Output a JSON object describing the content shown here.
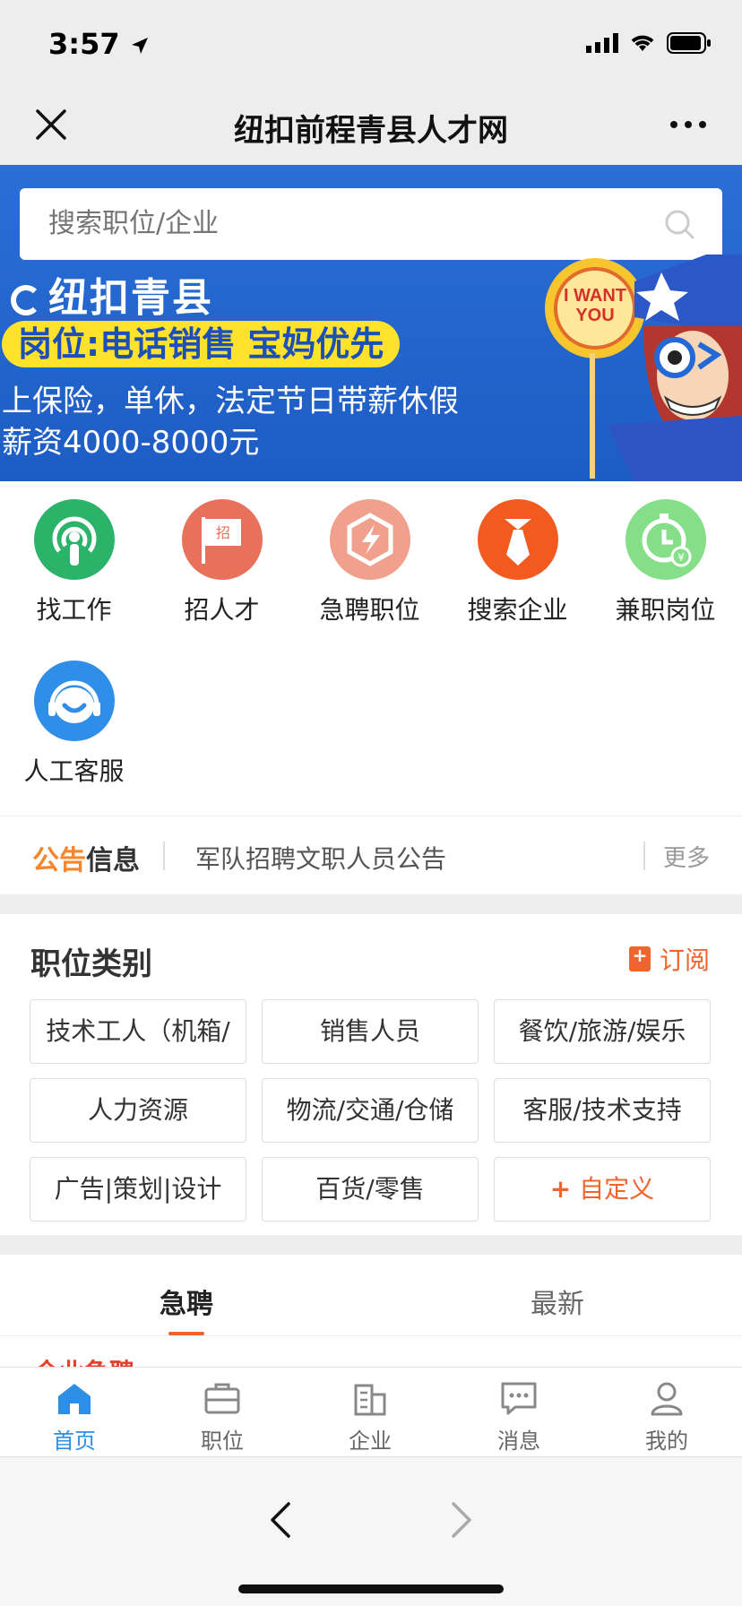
{
  "status_bar": {
    "time": "3:57"
  },
  "nav": {
    "title": "纽扣前程青县人才网"
  },
  "search": {
    "placeholder": "搜索职位/企业"
  },
  "banner": {
    "logo_text": "纽扣青县",
    "tag": "岗位:电话销售 宝妈优先",
    "line1": "上保险，单休，法定节日带薪休假",
    "line2": "薪资4000-8000元",
    "art_text": "I WANT YOU"
  },
  "quick_links": [
    {
      "label": "找工作",
      "icon": "podcast-person-icon",
      "color": "#2bb36a"
    },
    {
      "label": "招人才",
      "icon": "recruit-flag-icon",
      "color": "#e8715b"
    },
    {
      "label": "急聘职位",
      "icon": "lightning-icon",
      "color": "#f0a08c"
    },
    {
      "label": "搜索企业",
      "icon": "tie-icon",
      "color": "#f25a1f"
    },
    {
      "label": "兼职岗位",
      "icon": "clock-yen-icon",
      "color": "#85df88"
    },
    {
      "label": "人工客服",
      "icon": "headset-smile-icon",
      "color": "#2f8ee8"
    }
  ],
  "notice": {
    "title_a": "公告",
    "title_b": "信息",
    "text": "军队招聘文职人员公告",
    "more": "更多"
  },
  "categories": {
    "title": "职位类别",
    "subscribe": "订阅",
    "items": [
      "技术工人（机箱/",
      "销售人员",
      "餐饮/旅游/娱乐",
      "人力资源",
      "物流/交通/仓储",
      "客服/技术支持",
      "广告|策划|设计",
      "百货/零售"
    ],
    "custom": "自定义"
  },
  "tabs": {
    "active": "急聘",
    "inactive": "最新",
    "peek": "企业急聘"
  },
  "bottom_nav": [
    {
      "label": "首页",
      "icon": "home-icon"
    },
    {
      "label": "职位",
      "icon": "briefcase-icon"
    },
    {
      "label": "企业",
      "icon": "building-icon"
    },
    {
      "label": "消息",
      "icon": "chat-icon"
    },
    {
      "label": "我的",
      "icon": "user-icon"
    }
  ],
  "colors": {
    "accent": "#f0642e",
    "brand_blue": "#2d8ee6"
  }
}
